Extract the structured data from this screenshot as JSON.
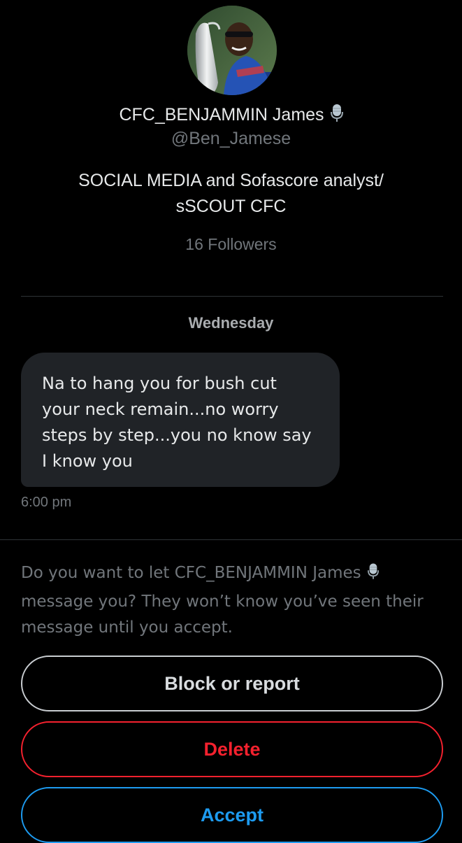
{
  "profile": {
    "display_name": "CFC_BENJAMMIN James",
    "name_emoji": "microphone-icon",
    "handle": "@Ben_Jamese",
    "bio_line1": "SOCIAL MEDIA and Sofascore analyst/",
    "bio_line2": "sSCOUT CFC",
    "followers": "16 Followers"
  },
  "conversation": {
    "day_label": "Wednesday",
    "messages": [
      {
        "lines": [
          "Na to hang you for bush cut",
          "your neck remain...no worry",
          "steps by step...you no know say",
          "I know you"
        ],
        "time": "6:00 pm"
      }
    ]
  },
  "request": {
    "line1": "Do you want to let CFC_BENJAMMIN James",
    "line2": "message you? They won’t know you’ve seen their",
    "line3": "message until you accept."
  },
  "actions": {
    "block_label": "Block or report",
    "delete_label": "Delete",
    "accept_label": "Accept"
  },
  "colors": {
    "background": "#000000",
    "primary_text": "#e7e9ea",
    "secondary_text": "#71767b",
    "bubble": "#202327",
    "delete": "#f4212e",
    "accept": "#1d9bf0"
  }
}
